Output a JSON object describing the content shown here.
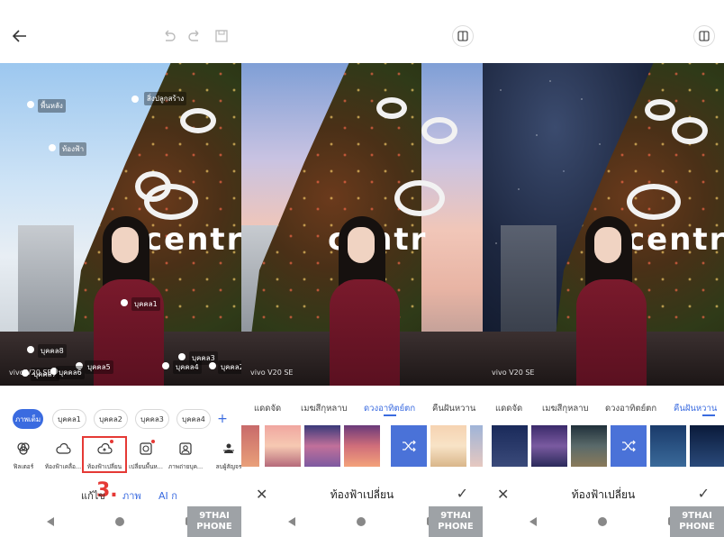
{
  "panel1": {
    "top_icons": [
      "back-arrow-icon",
      "undo-icon",
      "redo-icon",
      "save-icon"
    ],
    "segment_labels": {
      "background": "พื้นหลัง",
      "building": "สิ่งปลูกสร้าง",
      "sky": "ท้องฟ้า",
      "person1": "บุคคล1",
      "person2": "บุคคล2",
      "person3": "บุคคล3",
      "person4": "บุคคล4",
      "person5": "บุคคล5",
      "person6": "บุคคล6",
      "person7": "บุคคล7",
      "person8": "บุคคล8"
    },
    "watermark": "vivo V20 SE",
    "chips": [
      "ภาพเต็ม",
      "บุคคล1",
      "บุคคล2",
      "บุคคล3",
      "บุคคล4"
    ],
    "chip_add": "+",
    "tools": [
      {
        "label": "ฟิลเตอร์",
        "icon": "filter-icon"
      },
      {
        "label": "ท้องฟ้าเคลื่อ...",
        "icon": "cloud-icon"
      },
      {
        "label": "ท้องฟ้าเปลี่ยน",
        "icon": "cloud-change-icon"
      },
      {
        "label": "เปลี่ยนพื้นห...",
        "icon": "background-change-icon"
      },
      {
        "label": "ภาพถ่ายบุค...",
        "icon": "portrait-icon"
      },
      {
        "label": "ลบผู้สัญจร",
        "icon": "passerby-remove-icon"
      }
    ],
    "step_number": "3.",
    "bottom_tabs": [
      "แก้ไข",
      "ภาพ",
      "AI ก"
    ]
  },
  "panel2": {
    "filter_tabs": [
      "แดดจัด",
      "เมฆสีกุหลาบ",
      "ดวงอาทิตย์ตก",
      "คืนฝันหวาน"
    ],
    "active_tab": "ดวงอาทิตย์ตก",
    "title": "ท้องฟ้าเปลี่ยน",
    "watermark": "vivo V20 SE"
  },
  "panel3": {
    "filter_tabs": [
      "แดดจัด",
      "เมฆสีกุหลาบ",
      "ดวงอาทิตย์ตก",
      "คืนฝันหวาน"
    ],
    "active_tab": "คืนฝันหวาน",
    "title": "ท้องฟ้าเปลี่ยน",
    "watermark": "vivo V20 SE"
  },
  "site_watermark": {
    "line1": "9THAI",
    "line2": "PHONE"
  },
  "colors": {
    "accent": "#3a6be0",
    "highlight": "#e53935"
  }
}
